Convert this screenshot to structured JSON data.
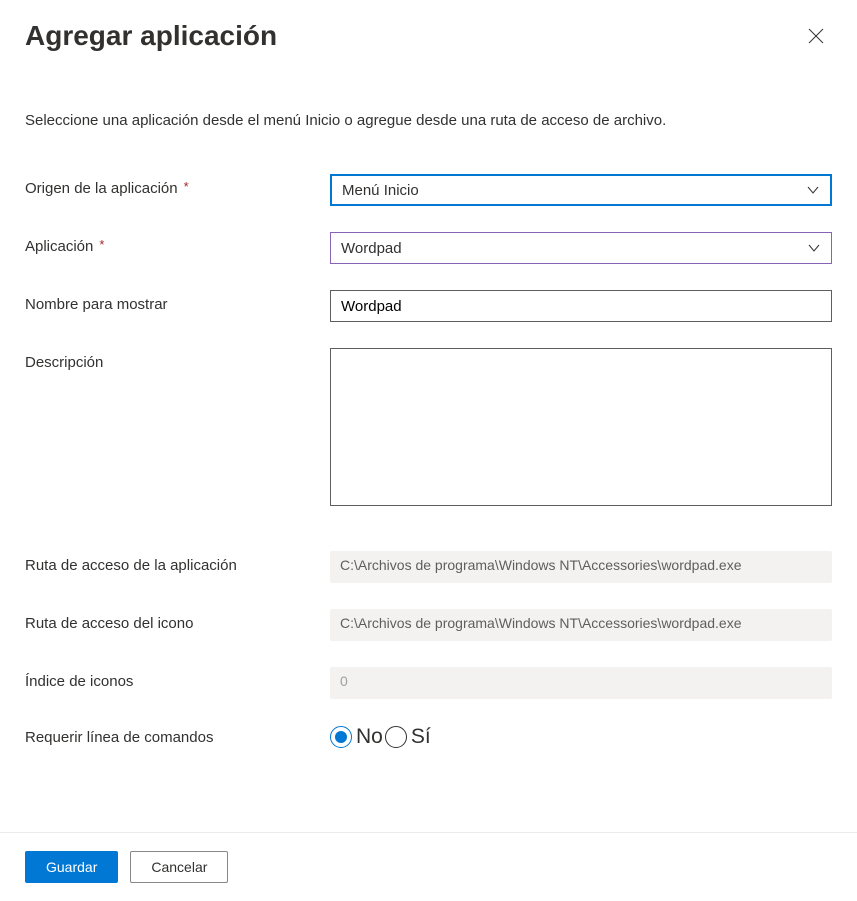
{
  "header": {
    "title": "Agregar aplicación",
    "subtitle": "Seleccione una aplicación desde el menú Inicio o agregue desde una ruta de acceso de archivo."
  },
  "form": {
    "source": {
      "label": "Origen de la aplicación",
      "value": "Menú Inicio"
    },
    "application": {
      "label": "Aplicación",
      "value": "Wordpad"
    },
    "displayName": {
      "label": "Nombre para mostrar",
      "value": "Wordpad"
    },
    "description": {
      "label": "Descripción",
      "value": ""
    },
    "appPath": {
      "label": "Ruta de acceso de la aplicación",
      "value": "C:\\Archivos de programa\\Windows NT\\Accessories\\wordpad.exe"
    },
    "iconPath": {
      "label": "Ruta de acceso del icono",
      "value": "C:\\Archivos de programa\\Windows NT\\Accessories\\wordpad.exe"
    },
    "iconIndex": {
      "label": "Índice de iconos",
      "value": "0"
    },
    "requireCmd": {
      "label": "Requerir línea de comandos",
      "optionNo": "No",
      "optionYes": "Sí",
      "selected": "No"
    }
  },
  "footer": {
    "save": "Guardar",
    "cancel": "Cancelar"
  }
}
